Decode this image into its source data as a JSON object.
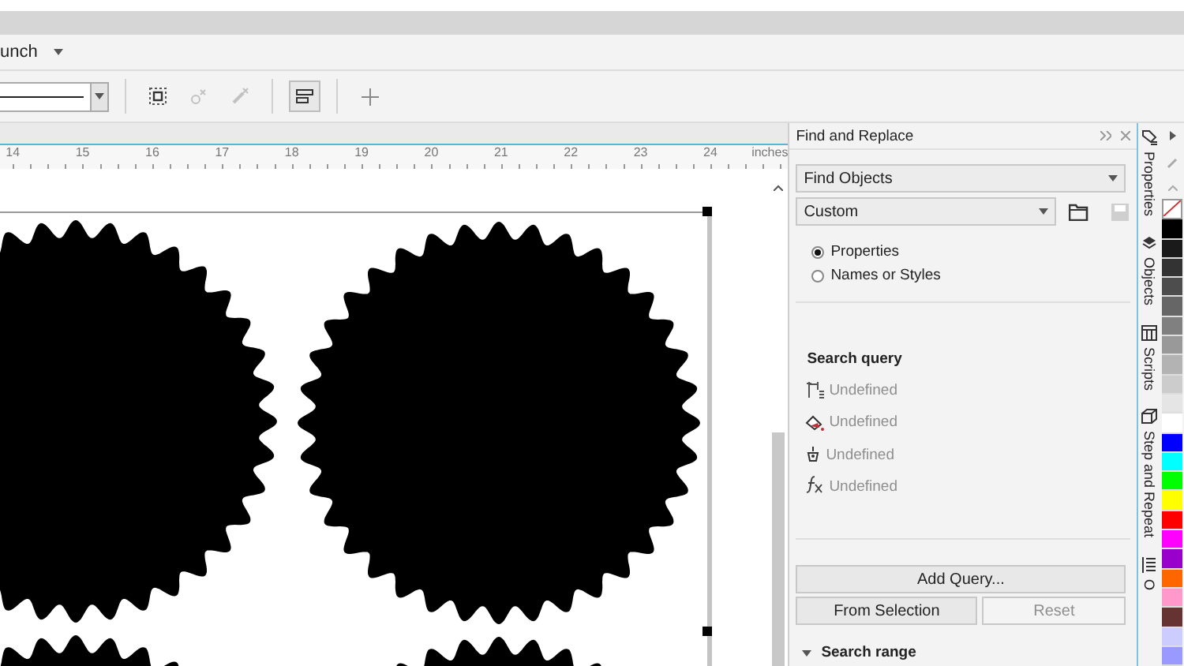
{
  "menu_bar": {
    "label": "unch"
  },
  "toolbar": {
    "buttons": [
      {
        "disabled": false,
        "selected": false
      },
      {
        "disabled": true,
        "selected": false
      },
      {
        "disabled": true,
        "selected": false
      },
      {
        "disabled": false,
        "selected": true
      },
      {
        "disabled": false,
        "selected": false
      }
    ]
  },
  "ruler": {
    "labels": [
      "14",
      "15",
      "16",
      "17",
      "18",
      "19",
      "20",
      "21",
      "22",
      "23",
      "24"
    ],
    "unit": "inches"
  },
  "panel": {
    "title": "Find and Replace",
    "mode_dropdown": {
      "value": "Find Objects"
    },
    "preset_dropdown": {
      "value": "Custom"
    },
    "save_disabled": true,
    "radios": [
      {
        "label": "Properties",
        "selected": true
      },
      {
        "label": "Names or Styles",
        "selected": false
      }
    ],
    "search_query": {
      "title": "Search query",
      "items": [
        {
          "label": "Undefined",
          "disabled": true
        },
        {
          "label": "Undefined",
          "disabled": true
        },
        {
          "label": "Undefined",
          "disabled": true
        },
        {
          "label": "Undefined",
          "disabled": true
        }
      ]
    },
    "buttons": [
      {
        "label": "Add Query...",
        "disabled": false
      },
      {
        "label": "From Selection",
        "disabled": false
      },
      {
        "label": "Reset",
        "disabled": true
      }
    ],
    "search_range": {
      "label": "Search range",
      "expanded": true
    }
  },
  "docker_tabs": [
    {
      "label": "Properties"
    },
    {
      "label": "Objects"
    },
    {
      "label": "Scripts"
    },
    {
      "label": "Step and Repeat"
    },
    {
      "label": "O"
    }
  ],
  "palette": [
    {
      "kind": "none"
    },
    {
      "kind": "swatch",
      "color": "#000000"
    },
    {
      "kind": "swatch",
      "color": "#1a1a1a"
    },
    {
      "kind": "swatch",
      "color": "#333333"
    },
    {
      "kind": "swatch",
      "color": "#4d4d4d"
    },
    {
      "kind": "swatch",
      "color": "#666666"
    },
    {
      "kind": "swatch",
      "color": "#808080"
    },
    {
      "kind": "swatch",
      "color": "#999999"
    },
    {
      "kind": "swatch",
      "color": "#b3b3b3"
    },
    {
      "kind": "swatch",
      "color": "#cccccc"
    },
    {
      "kind": "swatch",
      "color": "#e5e5e5"
    },
    {
      "kind": "swatch",
      "color": "#ffffff"
    },
    {
      "kind": "swatch",
      "color": "#0000ff"
    },
    {
      "kind": "swatch",
      "color": "#00ffff"
    },
    {
      "kind": "swatch",
      "color": "#00ff00"
    },
    {
      "kind": "swatch",
      "color": "#ffff00"
    },
    {
      "kind": "swatch",
      "color": "#ff0000"
    },
    {
      "kind": "swatch",
      "color": "#ff00ff"
    },
    {
      "kind": "swatch",
      "color": "#9900cc"
    },
    {
      "kind": "swatch",
      "color": "#ff6600"
    },
    {
      "kind": "swatch",
      "color": "#ff99cc"
    },
    {
      "kind": "swatch",
      "color": "#663333"
    },
    {
      "kind": "swatch",
      "color": "#ccccff"
    },
    {
      "kind": "swatch",
      "color": "#9999ff"
    }
  ]
}
